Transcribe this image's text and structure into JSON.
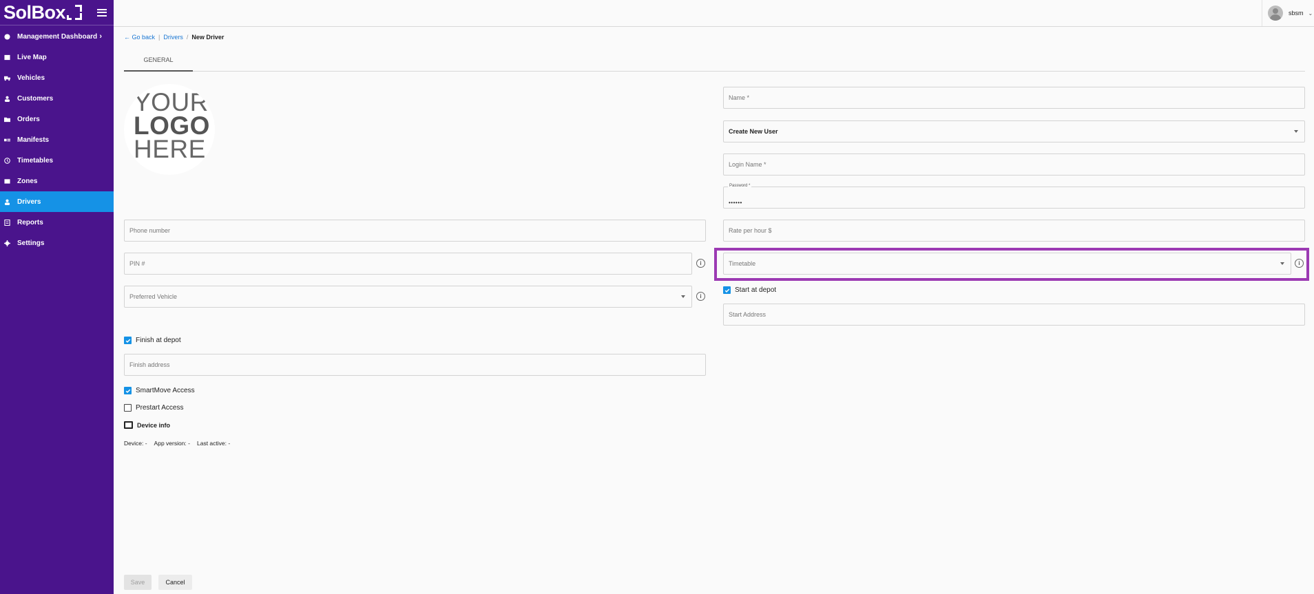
{
  "app": {
    "brand": "SolBox",
    "accent_color": "#4a148c",
    "active_color": "#1592e6",
    "highlight_color": "#9c3ab3"
  },
  "sidebar": {
    "items": [
      {
        "label": "Management Dashboard",
        "icon": "dashboard-icon",
        "chevron": "›"
      },
      {
        "label": "Live Map",
        "icon": "map-icon"
      },
      {
        "label": "Vehicles",
        "icon": "truck-icon"
      },
      {
        "label": "Customers",
        "icon": "person-icon"
      },
      {
        "label": "Orders",
        "icon": "folder-icon"
      },
      {
        "label": "Manifests",
        "icon": "manifest-icon"
      },
      {
        "label": "Timetables",
        "icon": "clock-icon"
      },
      {
        "label": "Zones",
        "icon": "zone-icon"
      },
      {
        "label": "Drivers",
        "icon": "driver-icon",
        "active": true
      },
      {
        "label": "Reports",
        "icon": "report-icon"
      },
      {
        "label": "Settings",
        "icon": "gear-icon"
      }
    ]
  },
  "topbar": {
    "username": "sbsm"
  },
  "breadcrumb": {
    "back": "Go back",
    "sep1": "|",
    "parent": "Drivers",
    "sep2": "/",
    "current": "New Driver"
  },
  "tabs": [
    {
      "label": "GENERAL",
      "active": true
    }
  ],
  "logo_placeholder": {
    "line1": "YOUR",
    "line2": "LOGO",
    "line3": "HERE"
  },
  "form": {
    "name_placeholder": "Name *",
    "user_select_value": "Create New User",
    "login_name_placeholder": "Login Name *",
    "password_label": "Password *",
    "password_value": "••••••",
    "phone_placeholder": "Phone number",
    "rate_placeholder": "Rate per hour $",
    "pin_placeholder": "PIN #",
    "timetable_placeholder": "Timetable",
    "preferred_vehicle_placeholder": "Preferred Vehicle",
    "start_at_depot_label": "Start at depot",
    "start_at_depot_checked": true,
    "start_address_placeholder": "Start Address",
    "finish_at_depot_label": "Finish at depot",
    "finish_at_depot_checked": true,
    "finish_address_placeholder": "Finish address",
    "smartmove_label": "SmartMove Access",
    "smartmove_checked": true,
    "prestart_label": "Prestart Access",
    "prestart_checked": false,
    "device_info_label": "Device info",
    "device": "Device: -",
    "app_version": "App version: -",
    "last_active": "Last active: -"
  },
  "buttons": {
    "save": "Save",
    "cancel": "Cancel"
  }
}
